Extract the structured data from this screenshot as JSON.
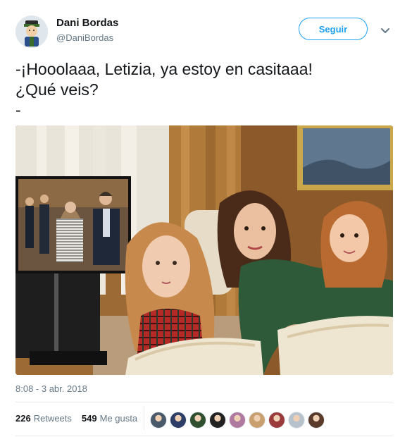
{
  "author": {
    "display_name": "Dani Bordas",
    "handle": "@DaniBordas",
    "avatar_icon": "playmobil-figure-avatar-icon"
  },
  "follow_button": {
    "label": "Seguir"
  },
  "more_menu": {
    "icon": "chevron-down-icon"
  },
  "tweet": {
    "lines": [
      "-¡Hooolaaa, Letizia, ya estoy en casitaaa!",
      "¿Qué veis?",
      "-"
    ]
  },
  "media": {
    "description_icon": "photo-image"
  },
  "timestamp": "8:08 - 3 abr. 2018",
  "stats": {
    "retweets_count": "226",
    "retweets_label": "Retweets",
    "likes_count": "549",
    "likes_label": "Me gusta"
  },
  "likers": [
    {
      "icon": "liker-avatar-icon",
      "color": "#4a5a6a"
    },
    {
      "icon": "liker-avatar-icon",
      "color": "#2c3e66"
    },
    {
      "icon": "liker-avatar-icon",
      "color": "#2f4f2f"
    },
    {
      "icon": "liker-avatar-icon",
      "color": "#222222"
    },
    {
      "icon": "liker-avatar-icon",
      "color": "#b07aa0"
    },
    {
      "icon": "liker-avatar-icon",
      "color": "#c8a070"
    },
    {
      "icon": "liker-avatar-icon",
      "color": "#9a3a3a"
    },
    {
      "icon": "liker-avatar-icon",
      "color": "#b8c2cc"
    },
    {
      "icon": "liker-avatar-icon",
      "color": "#5a3a2a"
    }
  ],
  "colors": {
    "accent": "#1da1f2",
    "text": "#14171a",
    "muted": "#657786"
  }
}
